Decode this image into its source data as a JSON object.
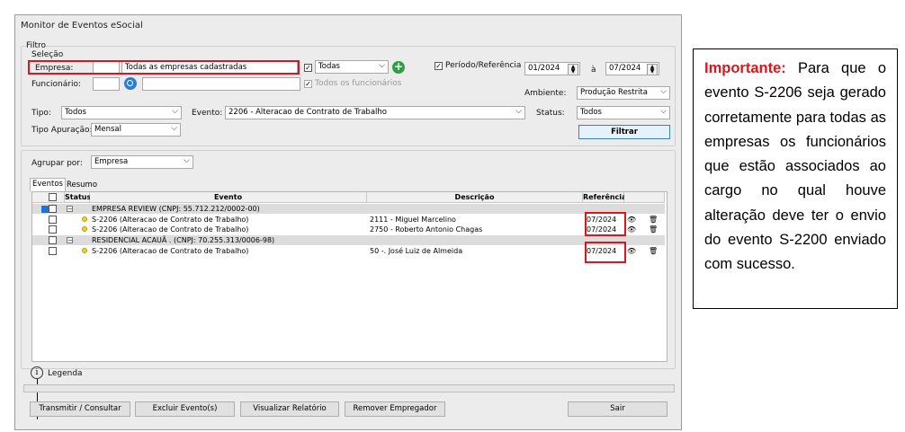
{
  "window": {
    "title": "Monitor de Eventos eSocial"
  },
  "filter": {
    "group_label": "Filtro",
    "selection_label": "Seleção",
    "empresa_label": "Empresa:",
    "empresa_code": "",
    "empresa_value": "Todas as empresas cadastradas",
    "empresa_select": "Todas",
    "funcionario_label": "Funcionário:",
    "funcionario_code": "",
    "funcionario_value": "",
    "todos_funcionarios": "Todos os funcionários",
    "periodo_label": "Período/Referência",
    "periodo_from": "01/2024",
    "periodo_sep": "à",
    "periodo_to": "07/2024",
    "ambiente_label": "Ambiente:",
    "ambiente_value": "Produção Restrita",
    "tipo_label": "Tipo:",
    "tipo_value": "Todos",
    "evento_label": "Evento:",
    "evento_value": "2206 - Alteracao de Contrato de Trabalho",
    "status_label": "Status:",
    "status_value": "Todos",
    "tipo_apuracao_label": "Tipo Apuração:",
    "tipo_apuracao_value": "Mensal",
    "filtrar_button": "Filtrar"
  },
  "group": {
    "label": "Agrupar por:",
    "value": "Empresa"
  },
  "tabs": [
    {
      "label": "Eventos"
    },
    {
      "label": "Resumo"
    }
  ],
  "table": {
    "headers": [
      "Status",
      "Evento",
      "Descrição",
      "Referência"
    ],
    "rows": [
      {
        "type": "group",
        "evento": "EMPRESA REVIEW (CNPJ: 55.712.212/0002-00)"
      },
      {
        "type": "item",
        "evento": "S-2206 (Alteracao de Contrato de Trabalho)",
        "descricao": "2111 -  Miguel Marcelino",
        "referencia": "07/2024"
      },
      {
        "type": "item",
        "evento": "S-2206 (Alteracao de Contrato de Trabalho)",
        "descricao": "2750 - Roberto Antonio Chagas",
        "referencia": "07/2024"
      },
      {
        "type": "group",
        "evento": "RESIDENCIAL ACAUÃ           . (CNPJ: 70.255.313/0006-98)"
      },
      {
        "type": "item",
        "evento": "S-2206 (Alteracao de Contrato de Trabalho)",
        "descricao": "50 -. José Luiz de Almeida",
        "referencia": "07/2024"
      }
    ]
  },
  "legend": {
    "label": "Legenda"
  },
  "buttons": {
    "transmitir": "Transmitir / Consultar",
    "excluir": "Excluir Evento(s)",
    "visualizar": "Visualizar Relatório",
    "remover": "Remover Empregador",
    "sair": "Sair"
  },
  "note": {
    "highlight": "Importante:",
    "text": "Para que o evento S-2206 seja gerado corretamente para todas as empresas os funcionários que estão associados ao cargo no qual houve alteração deve ter o envio do evento S-2200 enviado com sucesso."
  },
  "colors": {
    "highlight_red": "#e0141b",
    "status_yellow": "#f1d22a",
    "add_green": "#2ea043",
    "search_blue": "#2d7dd2"
  }
}
